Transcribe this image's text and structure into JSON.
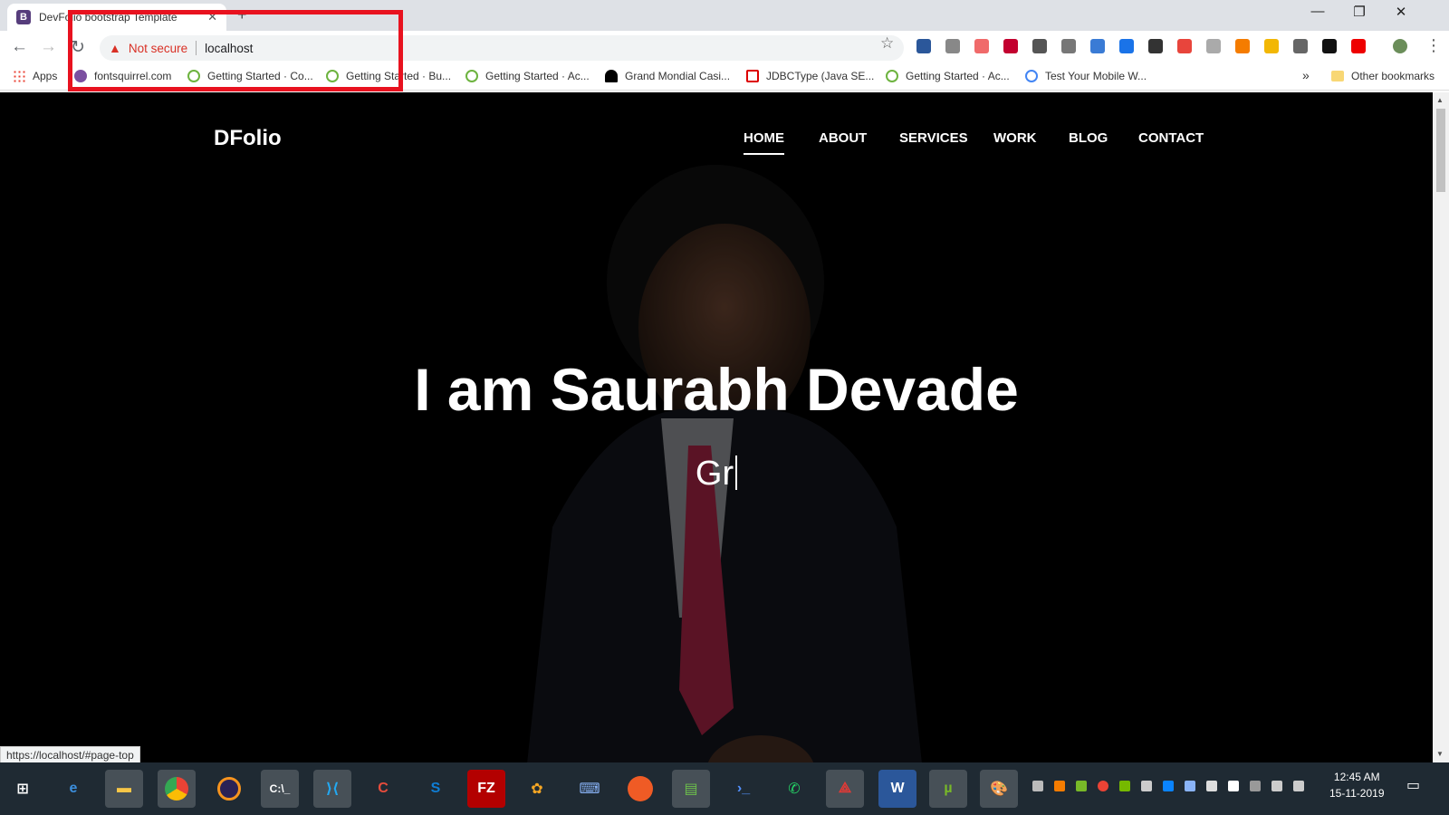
{
  "browser": {
    "tab_title": "DevFolio bootstrap Template",
    "tab_favicon": "B",
    "security_label": "Not secure",
    "url": "localhost",
    "bookmarks": [
      {
        "label": "Apps",
        "icon": "apps-grid-icon"
      },
      {
        "label": "fontsquirrel.com",
        "icon": "fontsquirrel-icon"
      },
      {
        "label": "Getting Started · Co...",
        "icon": "spring-leaf-icon"
      },
      {
        "label": "Getting Started · Bu...",
        "icon": "spring-leaf-icon"
      },
      {
        "label": "Getting Started · Ac...",
        "icon": "spring-leaf-icon"
      },
      {
        "label": "Grand Mondial Casi...",
        "icon": "spade-icon"
      },
      {
        "label": "JDBCType (Java SE...",
        "icon": "java-icon"
      },
      {
        "label": "Getting Started · Ac...",
        "icon": "spring-leaf-icon"
      },
      {
        "label": "Test Your Mobile W...",
        "icon": "google-icon"
      }
    ],
    "bookmarks_overflow": "»",
    "other_bookmarks": "Other bookmarks",
    "status_url": "https://localhost/#page-top"
  },
  "site": {
    "brand": "DFolio",
    "nav": [
      {
        "label": "HOME",
        "active": true
      },
      {
        "label": "ABOUT",
        "active": false
      },
      {
        "label": "SERVICES",
        "active": false
      },
      {
        "label": "WORK",
        "active": false
      },
      {
        "label": "BLOG",
        "active": false
      },
      {
        "label": "CONTACT",
        "active": false
      }
    ],
    "hero_title": "I am Saurabh Devade",
    "hero_typed": "Gr"
  },
  "taskbar": {
    "apps": [
      "windows-start-icon",
      "edge-icon",
      "file-explorer-icon",
      "chrome-icon",
      "eclipse-icon",
      "cmd-icon",
      "vscode-icon",
      "ccleaner-icon",
      "sublime-icon",
      "filezilla-icon",
      "davinci-icon",
      "network-tool-icon",
      "postman-icon",
      "project-icon",
      "powershell-icon",
      "whatsapp-icon",
      "acrobat-icon",
      "word-icon",
      "utorrent-icon",
      "paint-icon"
    ],
    "time": "12:45 AM",
    "date": "15-11-2019"
  },
  "colors": {
    "highlight_box": "#e8121f",
    "not_secure": "#d93025",
    "taskbar": "#1f2a33"
  }
}
